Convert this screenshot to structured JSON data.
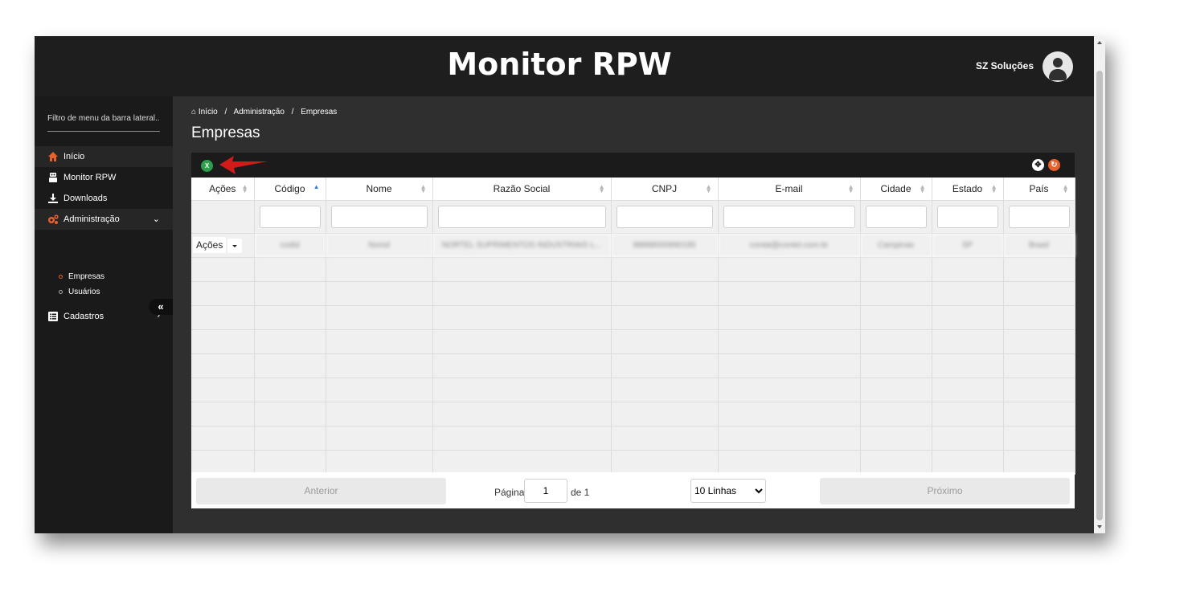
{
  "app": {
    "title": "Monitor RPW",
    "user_name": "SZ Soluções"
  },
  "sidebar": {
    "filter_placeholder": "Filtro de menu da barra lateral...",
    "items": [
      {
        "label": "Início",
        "icon": "home-icon"
      },
      {
        "label": "Monitor RPW",
        "icon": "robot-icon"
      },
      {
        "label": "Downloads",
        "icon": "download-icon"
      },
      {
        "label": "Administração",
        "icon": "cogs-icon"
      },
      {
        "label": "Cadastros",
        "icon": "list-icon"
      }
    ],
    "sub_items": [
      {
        "label": "Empresas"
      },
      {
        "label": "Usuários"
      }
    ],
    "collapse_label": "«"
  },
  "breadcrumb": {
    "home": "Início",
    "level1": "Administração",
    "level2": "Empresas"
  },
  "page": {
    "title": "Empresas"
  },
  "table": {
    "columns": [
      "Ações",
      "Código",
      "Nome",
      "Razão Social",
      "CNPJ",
      "E-mail",
      "Cidade",
      "Estado",
      "País"
    ],
    "row": {
      "acoes": "Ações",
      "codigo": "codid",
      "nome": "Nomd",
      "razao_social": "NORTEL SUPRIMENTOS INDUSTRIAIS L...",
      "cnpj": "88888000890195",
      "email": "contat@contet.com.br",
      "cidade": "Campinas",
      "estado": "SP",
      "pais": "Brasil"
    }
  },
  "pagination": {
    "previous": "Anterior",
    "page_label": "Página",
    "page_value": "1",
    "of_label": "de 1",
    "rows_option": "10 Linhas",
    "next": "Próximo"
  },
  "colors": {
    "accent": "#e8602c",
    "dark": "#1e1e1e",
    "excel_green": "#2e9e4c",
    "annotation_red": "#d11a1a"
  }
}
